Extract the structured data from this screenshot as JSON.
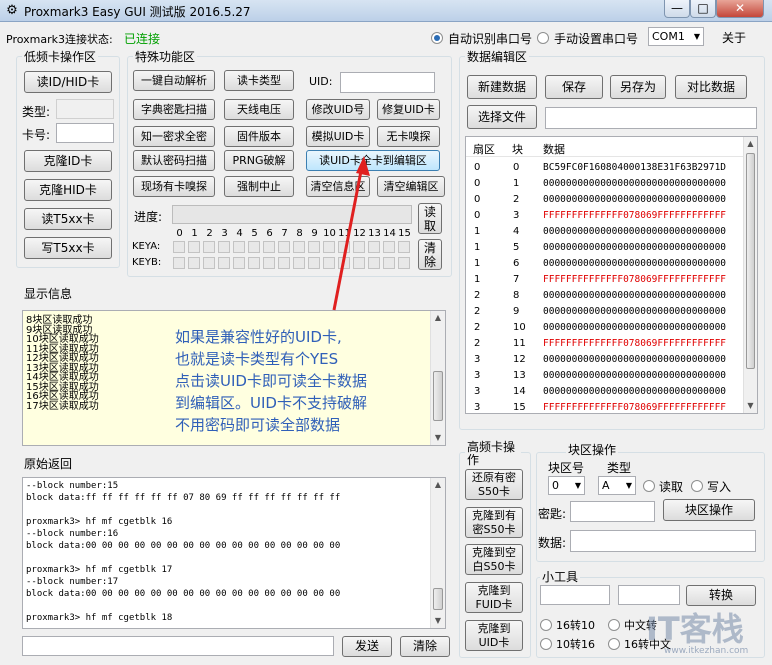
{
  "window": {
    "title": "Proxmark3 Easy GUI 测试版 2016.5.27",
    "buttons": [
      "—",
      "□",
      "✕"
    ]
  },
  "top": {
    "status_label": "Proxmark3连接状态:",
    "status_value": "已连接",
    "status_color": "#00a000",
    "radio_auto": "自动识别串口号",
    "radio_manual": "手动设置串口号",
    "port": "COM1",
    "about": "关于"
  },
  "lowfreq": {
    "title": "低频卡操作区",
    "read_btn": "读ID/HID卡",
    "type_label": "类型:",
    "card_label": "卡号:",
    "clone_id": "克隆ID卡",
    "clone_hid": "克隆HID卡",
    "read_t5": "读T5xx卡",
    "write_t5": "写T5xx卡"
  },
  "special": {
    "title": "特殊功能区",
    "buttons": [
      [
        "一键自动解析",
        "读卡类型"
      ],
      [
        "字典密匙扫描",
        "天线电压",
        "修改UID号",
        "修复UID卡"
      ],
      [
        "知一密求全密",
        "固件版本",
        "模拟UID卡",
        "无卡嗅探"
      ],
      [
        "默认密码扫描",
        "PRNG破解",
        "读UID卡全卡到编辑区"
      ],
      [
        "现场有卡嗅探",
        "强制中止",
        "清空信息区",
        "清空编辑区"
      ]
    ],
    "uid_label": "UID:",
    "progress_label": "进度:",
    "progress_value": 0,
    "read_btn": "读\n取",
    "clear_btn": "清\n除",
    "keya": "KEYA:",
    "keyb": "KEYB:",
    "digits": [
      "0",
      "1",
      "2",
      "3",
      "4",
      "5",
      "6",
      "7",
      "8",
      "9",
      "10",
      "11",
      "12",
      "13",
      "14",
      "15"
    ]
  },
  "info": {
    "title": "显示信息",
    "lines": [
      "8块区读取成功",
      "9块区读取成功",
      "10块区读取成功",
      "11块区读取成功",
      "12块区读取成功",
      "13块区读取成功",
      "14块区读取成功",
      "15块区读取成功",
      "16块区读取成功",
      "17块区读取成功"
    ]
  },
  "annotation": {
    "lines": [
      "如果是兼容性好的UID卡,",
      "也就是读卡类型有个YES",
      "点击读UID卡即可读全卡数据",
      "到编辑区。UID卡不支持破解",
      "不用密码即可读全部数据"
    ],
    "color": "#2f5fb8"
  },
  "raw": {
    "title": "原始返回",
    "lines": [
      "--block number:15",
      "block data:ff ff ff ff ff ff 07 80 69 ff ff ff ff ff ff ff",
      "",
      "proxmark3> hf mf cgetblk 16",
      "--block number:16",
      "block data:00 00 00 00 00 00 00 00 00 00 00 00 00 00 00 00",
      "",
      "proxmark3> hf mf cgetblk 17",
      "--block number:17",
      "block data:00 00 00 00 00 00 00 00 00 00 00 00 00 00 00 00",
      "",
      "proxmark3> hf mf cgetblk 18"
    ],
    "send": "发送",
    "clear": "清除"
  },
  "editor": {
    "title": "数据编辑区",
    "new": "新建数据",
    "save": "保存",
    "save_as": "另存为",
    "compare": "对比数据",
    "choose_file": "选择文件",
    "headers": [
      "扇区",
      "块",
      "数据"
    ],
    "rows": [
      {
        "sector": "0",
        "block": "0",
        "data": "BC59FC0F160804000138E31F63B2971D",
        "red": false
      },
      {
        "sector": "0",
        "block": "1",
        "data": "00000000000000000000000000000000",
        "red": false
      },
      {
        "sector": "0",
        "block": "2",
        "data": "00000000000000000000000000000000",
        "red": false
      },
      {
        "sector": "0",
        "block": "3",
        "data": "FFFFFFFFFFFFFF078069FFFFFFFFFFFF",
        "red": true
      },
      {
        "sector": "1",
        "block": "4",
        "data": "00000000000000000000000000000000",
        "red": false
      },
      {
        "sector": "1",
        "block": "5",
        "data": "00000000000000000000000000000000",
        "red": false
      },
      {
        "sector": "1",
        "block": "6",
        "data": "00000000000000000000000000000000",
        "red": false
      },
      {
        "sector": "1",
        "block": "7",
        "data": "FFFFFFFFFFFFFF078069FFFFFFFFFFFF",
        "red": true
      },
      {
        "sector": "2",
        "block": "8",
        "data": "00000000000000000000000000000000",
        "red": false
      },
      {
        "sector": "2",
        "block": "9",
        "data": "00000000000000000000000000000000",
        "red": false
      },
      {
        "sector": "2",
        "block": "10",
        "data": "00000000000000000000000000000000",
        "red": false
      },
      {
        "sector": "2",
        "block": "11",
        "data": "FFFFFFFFFFFFFF078069FFFFFFFFFFFF",
        "red": true
      },
      {
        "sector": "3",
        "block": "12",
        "data": "00000000000000000000000000000000",
        "red": false
      },
      {
        "sector": "3",
        "block": "13",
        "data": "00000000000000000000000000000000",
        "red": false
      },
      {
        "sector": "3",
        "block": "14",
        "data": "00000000000000000000000000000000",
        "red": false
      },
      {
        "sector": "3",
        "block": "15",
        "data": "FFFFFFFFFFFFFF078069FFFFFFFFFFFF",
        "red": true
      }
    ]
  },
  "hf": {
    "title": "高频卡操作",
    "btn1": "还原有密\nS50卡",
    "btn2": "克隆到有\n密S50卡",
    "btn3": "克隆到空\n白S50卡",
    "btn4": "克隆到\nFUID卡",
    "btn5": "克隆到\nUID卡"
  },
  "block": {
    "title": "块区操作",
    "block_label": "块区号",
    "type_label": "类型",
    "block_value": "0",
    "type_value": "A",
    "read": "读取",
    "write": "写入",
    "key_label": "密匙:",
    "op_btn": "块区操作",
    "data_label": "数据:"
  },
  "tools": {
    "title": "小工具",
    "convert": "转换",
    "r1": "16转10",
    "r2": "中文转",
    "r3": "10转16",
    "r4": "16转中文"
  },
  "watermark": {
    "big": "IT客栈",
    "small": "www.itkezhan.com"
  }
}
